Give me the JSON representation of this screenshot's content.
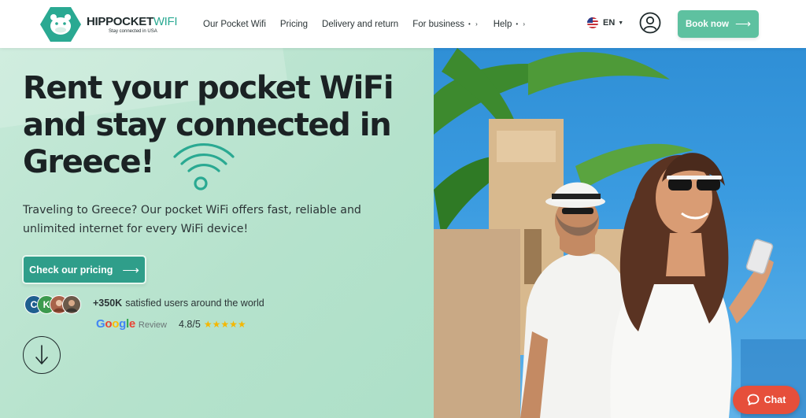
{
  "header": {
    "logo": {
      "main": "HIPPOCKET",
      "accent": "WIFI",
      "tagline": "Stay connected in USA"
    },
    "nav": [
      {
        "label": "Our Pocket Wifi",
        "has_dropdown": false
      },
      {
        "label": "Pricing",
        "has_dropdown": false
      },
      {
        "label": "Delivery and return",
        "has_dropdown": false
      },
      {
        "label": "For business",
        "has_dropdown": true
      },
      {
        "label": "Help",
        "has_dropdown": true
      }
    ],
    "language": "EN",
    "book_button": "Book now"
  },
  "hero": {
    "title": "Rent your pocket WiFi and stay connected in Greece!",
    "description": "Traveling to Greece? Our pocket WiFi offers fast, reliable and unlimited internet for every WiFi device!",
    "pricing_button": "Check our pricing",
    "users_count": "+350K",
    "users_text": "satisfied users around the world",
    "avatars": [
      {
        "initial": "C",
        "color": "#1f5f8f"
      },
      {
        "initial": "K",
        "color": "#3c9a4e"
      },
      {
        "initial": "",
        "color": "#a8634a"
      },
      {
        "initial": "",
        "color": "#6b5a4a"
      }
    ],
    "google_word": "Google",
    "review_label": "Review",
    "rating": "4.8/5",
    "stars": "★★★★★"
  },
  "chat": {
    "label": "Chat"
  },
  "colors": {
    "accent": "#5ec1a0",
    "dark_teal": "#2f9e8a",
    "chat": "#e64f3b",
    "hero_bg": "#bfe6d2"
  }
}
